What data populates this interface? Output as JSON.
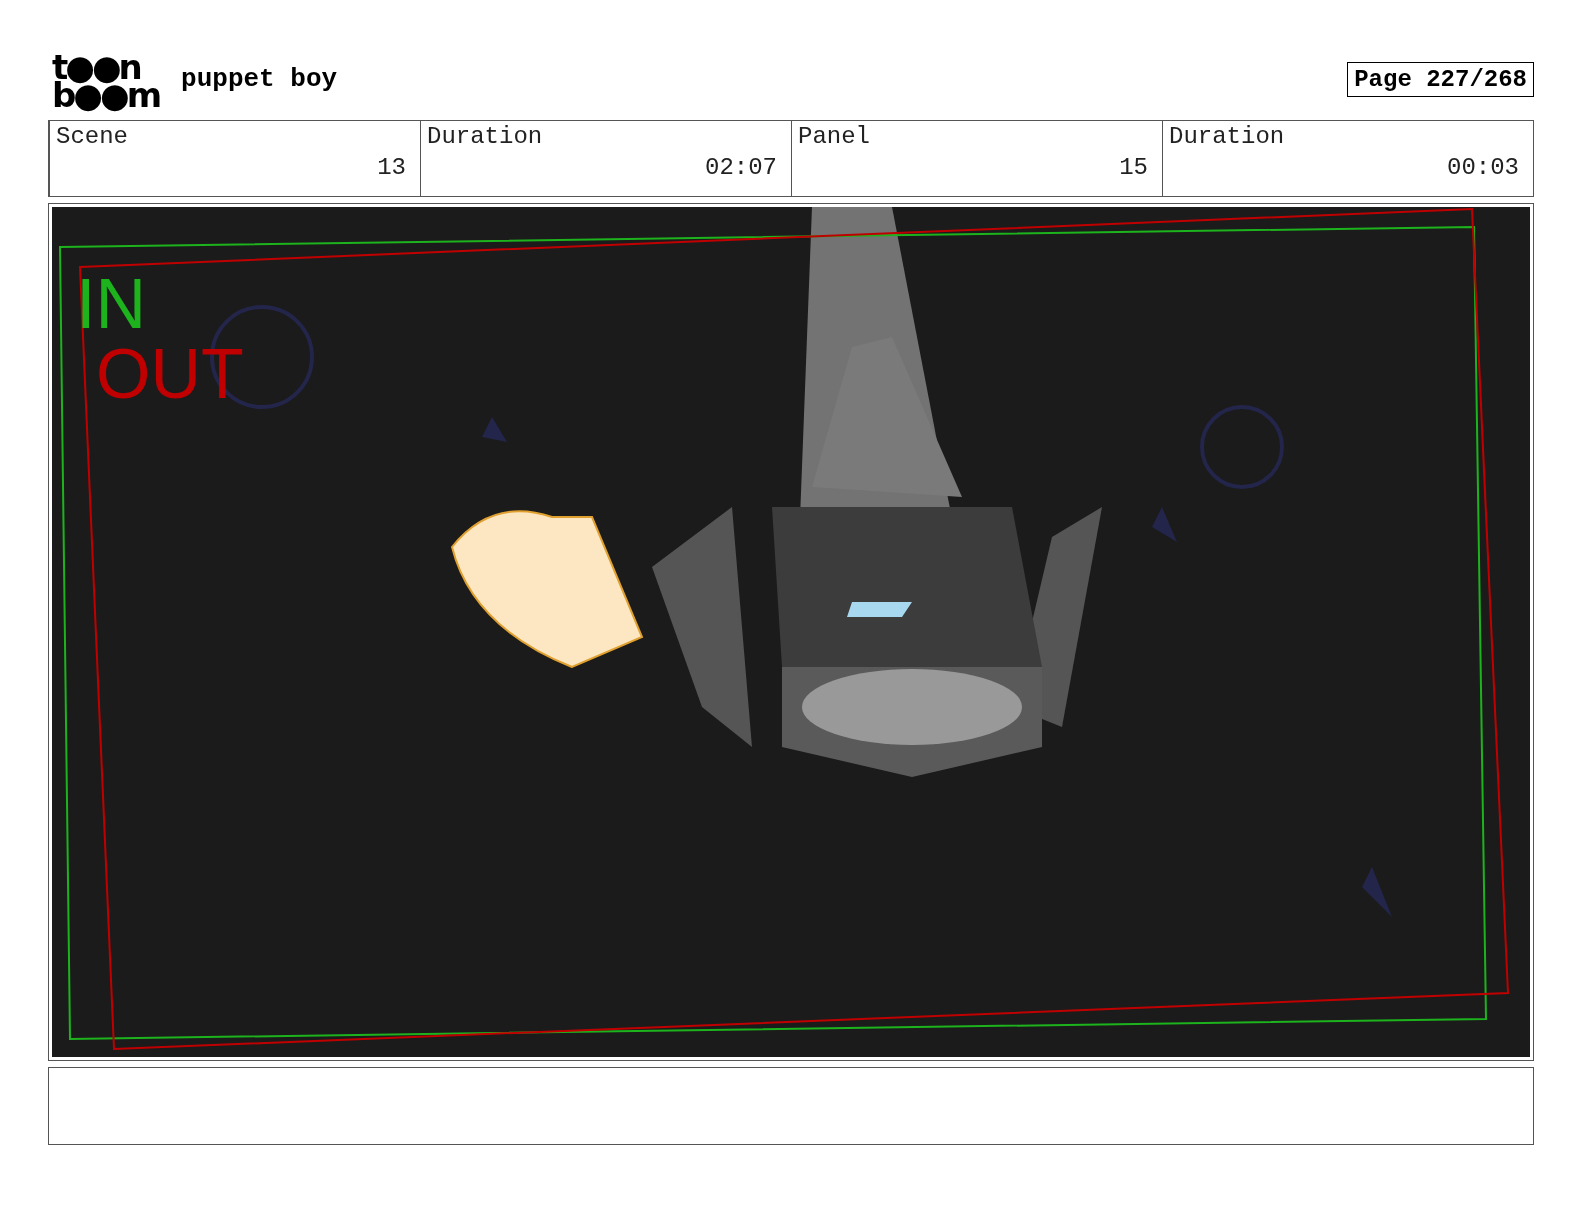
{
  "header": {
    "logo_lines": [
      "t●●n",
      "b●●m"
    ],
    "title": "puppet boy",
    "page": "Page 227/268"
  },
  "info": [
    {
      "label": "Scene",
      "value": "13"
    },
    {
      "label": "Duration",
      "value": "02:07"
    },
    {
      "label": "Panel",
      "value": "15"
    },
    {
      "label": "Duration",
      "value": "00:03"
    }
  ],
  "panel": {
    "frames": [
      {
        "label": "IN",
        "color": "#1db31d"
      },
      {
        "label": "OUT",
        "color": "#c00000"
      }
    ]
  }
}
